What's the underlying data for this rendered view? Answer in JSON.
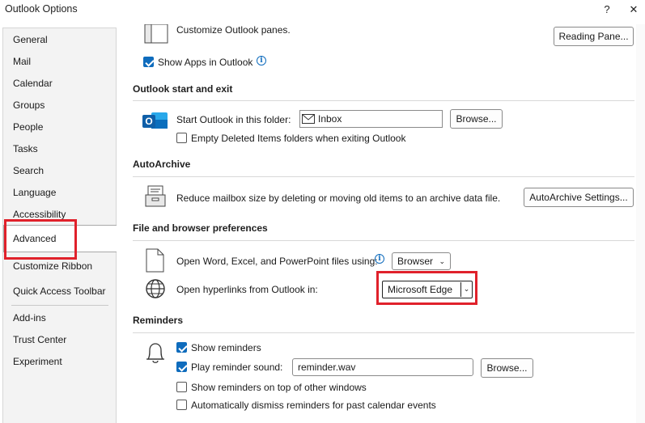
{
  "window": {
    "title": "Outlook Options",
    "help_label": "?",
    "close_label": "✕"
  },
  "sidebar": {
    "items": [
      {
        "label": "General"
      },
      {
        "label": "Mail"
      },
      {
        "label": "Calendar"
      },
      {
        "label": "Groups"
      },
      {
        "label": "People"
      },
      {
        "label": "Tasks"
      },
      {
        "label": "Search"
      },
      {
        "label": "Language"
      },
      {
        "label": "Accessibility"
      },
      {
        "label": "Advanced"
      },
      {
        "label": "Customize Ribbon"
      },
      {
        "label": "Quick Access Toolbar"
      },
      {
        "label": "Add-ins"
      },
      {
        "label": "Trust Center"
      },
      {
        "label": "Experiment"
      }
    ],
    "active": "Advanced"
  },
  "panes": {
    "customize_label": "Customize Outlook panes.",
    "reading_pane_button": "Reading Pane...",
    "show_apps_label": "Show Apps in Outlook",
    "show_apps_checked": true
  },
  "start_exit": {
    "title": "Outlook start and exit",
    "start_folder_label": "Start Outlook in this folder:",
    "start_folder_value": "Inbox",
    "browse_label": "Browse...",
    "empty_deleted_label": "Empty Deleted Items folders when exiting Outlook",
    "empty_deleted_checked": false
  },
  "autoarchive": {
    "title": "AutoArchive",
    "description": "Reduce mailbox size by deleting or moving old items to an archive data file.",
    "settings_button": "AutoArchive Settings..."
  },
  "file_browser": {
    "title": "File and browser preferences",
    "open_files_label": "Open Word, Excel, and PowerPoint files using:",
    "open_files_value": "Browser",
    "hyperlinks_label": "Open hyperlinks from Outlook in:",
    "hyperlinks_value": "Microsoft Edge"
  },
  "reminders": {
    "title": "Reminders",
    "show_reminders_label": "Show reminders",
    "show_reminders_checked": true,
    "play_sound_label": "Play reminder sound:",
    "play_sound_checked": true,
    "sound_file": "reminder.wav",
    "browse_label": "Browse...",
    "on_top_label": "Show reminders on top of other windows",
    "on_top_checked": false,
    "auto_dismiss_label": "Automatically dismiss reminders for past calendar events",
    "auto_dismiss_checked": false
  },
  "colors": {
    "accent": "#0f6cbd",
    "highlight": "#e0212b"
  }
}
